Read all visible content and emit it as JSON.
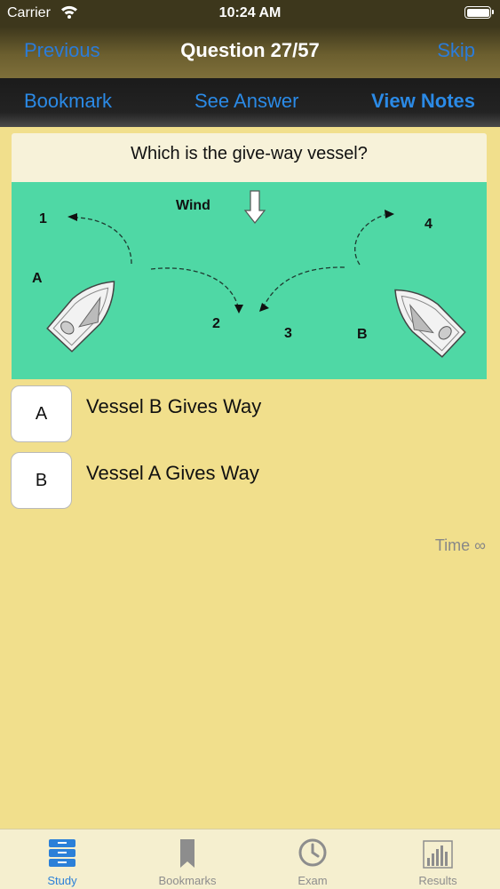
{
  "status_bar": {
    "carrier": "Carrier",
    "time": "10:24 AM"
  },
  "nav": {
    "previous_label": "Previous",
    "title": "Question 27/57",
    "skip_label": "Skip"
  },
  "actions": {
    "bookmark_label": "Bookmark",
    "see_answer_label": "See Answer",
    "view_notes_label": "View Notes"
  },
  "question": {
    "text": "Which is the give-way vessel?",
    "diagram_labels": {
      "wind": "Wind",
      "pos1": "1",
      "pos2": "2",
      "pos3": "3",
      "pos4": "4",
      "boat_a": "A",
      "boat_b": "B"
    }
  },
  "answers": [
    {
      "letter": "A",
      "text": "Vessel B Gives Way"
    },
    {
      "letter": "B",
      "text": "Vessel A Gives Way"
    }
  ],
  "timer": {
    "label": "Time ∞"
  },
  "tabs": [
    {
      "label": "Study",
      "icon": "study-stack-icon",
      "active": true
    },
    {
      "label": "Bookmarks",
      "icon": "bookmark-icon",
      "active": false
    },
    {
      "label": "Exam",
      "icon": "clock-icon",
      "active": false
    },
    {
      "label": "Results",
      "icon": "bar-chart-icon",
      "active": false
    }
  ],
  "colors": {
    "accent": "#2b80d8",
    "background": "#f1df8c",
    "diagram_water": "#4fd8a5"
  }
}
